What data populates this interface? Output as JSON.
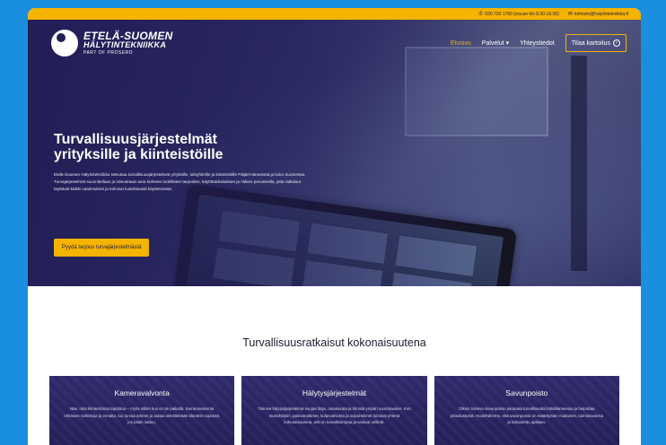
{
  "topbar": {
    "phone": "020 730 1700 (ma-pe klo 8.00-16.00)",
    "email": "toimisto@halytintekniikka.fi"
  },
  "brand": {
    "line1": "ETELÄ-SUOMEN",
    "line2": "HÄLYTINTEKNIIKKA",
    "line3": "PART OF PROSERO"
  },
  "nav": {
    "items": [
      "Etusivu",
      "Palvelut ▾",
      "Yhteystiedot"
    ],
    "cta": "Tilaa kartoitus"
  },
  "hero": {
    "title_1": "Turvallisuusjärjestelmät",
    "title_2": "yrityksille ja kiinteistöille",
    "body": "Etelä-Suomen Hälytintekniikka toteuttaa turvallisuusjärjestelmät yrityksille, taloyhtiöille ja kiinteistöille Päijät-Hämeessä ja koko Suomessa. Turvajärjestelmät suunnitellaan ja toteutetaan aina kohteen todellisten tarpeiden, käyttötarkoituksen ja riskien perusteella, jotta ratkaisut täyttävät kaikki vaatimukset ja toimivat luotettavasti käytännössä.",
    "button": "Pyydä tarjous turvajärjestelmästä"
  },
  "section": {
    "title": "Turvallisuusratkaisut kokonaisuutena"
  },
  "cards": [
    {
      "title": "Kameravalvonta",
      "body": "Näe, mitä kiinteistössä tapahtuu – myös silloin kun et ole paikalla. Kameravalvonta ehkäisee vahinkoja ja ennalta, tuo turvaa arkeen ja auttaa selvittämään tilanteet nopeasti, jos jotain sattuu."
    },
    {
      "title": "Hälytysjärjestelmät",
      "body": "Toimiva hälytysjärjestelmä suojaa tiloja, omaisuutta ja ihmisiä ympäri vuorokauden. Kun murtohälytin, palovaroittimet, kulunvalvonta ja ovipuhelimet toimivat yhtenä kokonaisuutena, arki on turvallisempaa ja vastuut selkeät."
    },
    {
      "title": "Savunpoisto",
      "body": "Oikein toimiva savunpoisto parantaa turvallisuutta hätätilanteessa ja helpottaa pelastustyötä. Huolehdimme, että savunpoisto on määräysten mukainen, toimintavarma ja tarkastettu ajallaan."
    }
  ],
  "colors": {
    "background": "#1a8fe0",
    "accent": "#f5b400",
    "navy": "#231f57"
  }
}
